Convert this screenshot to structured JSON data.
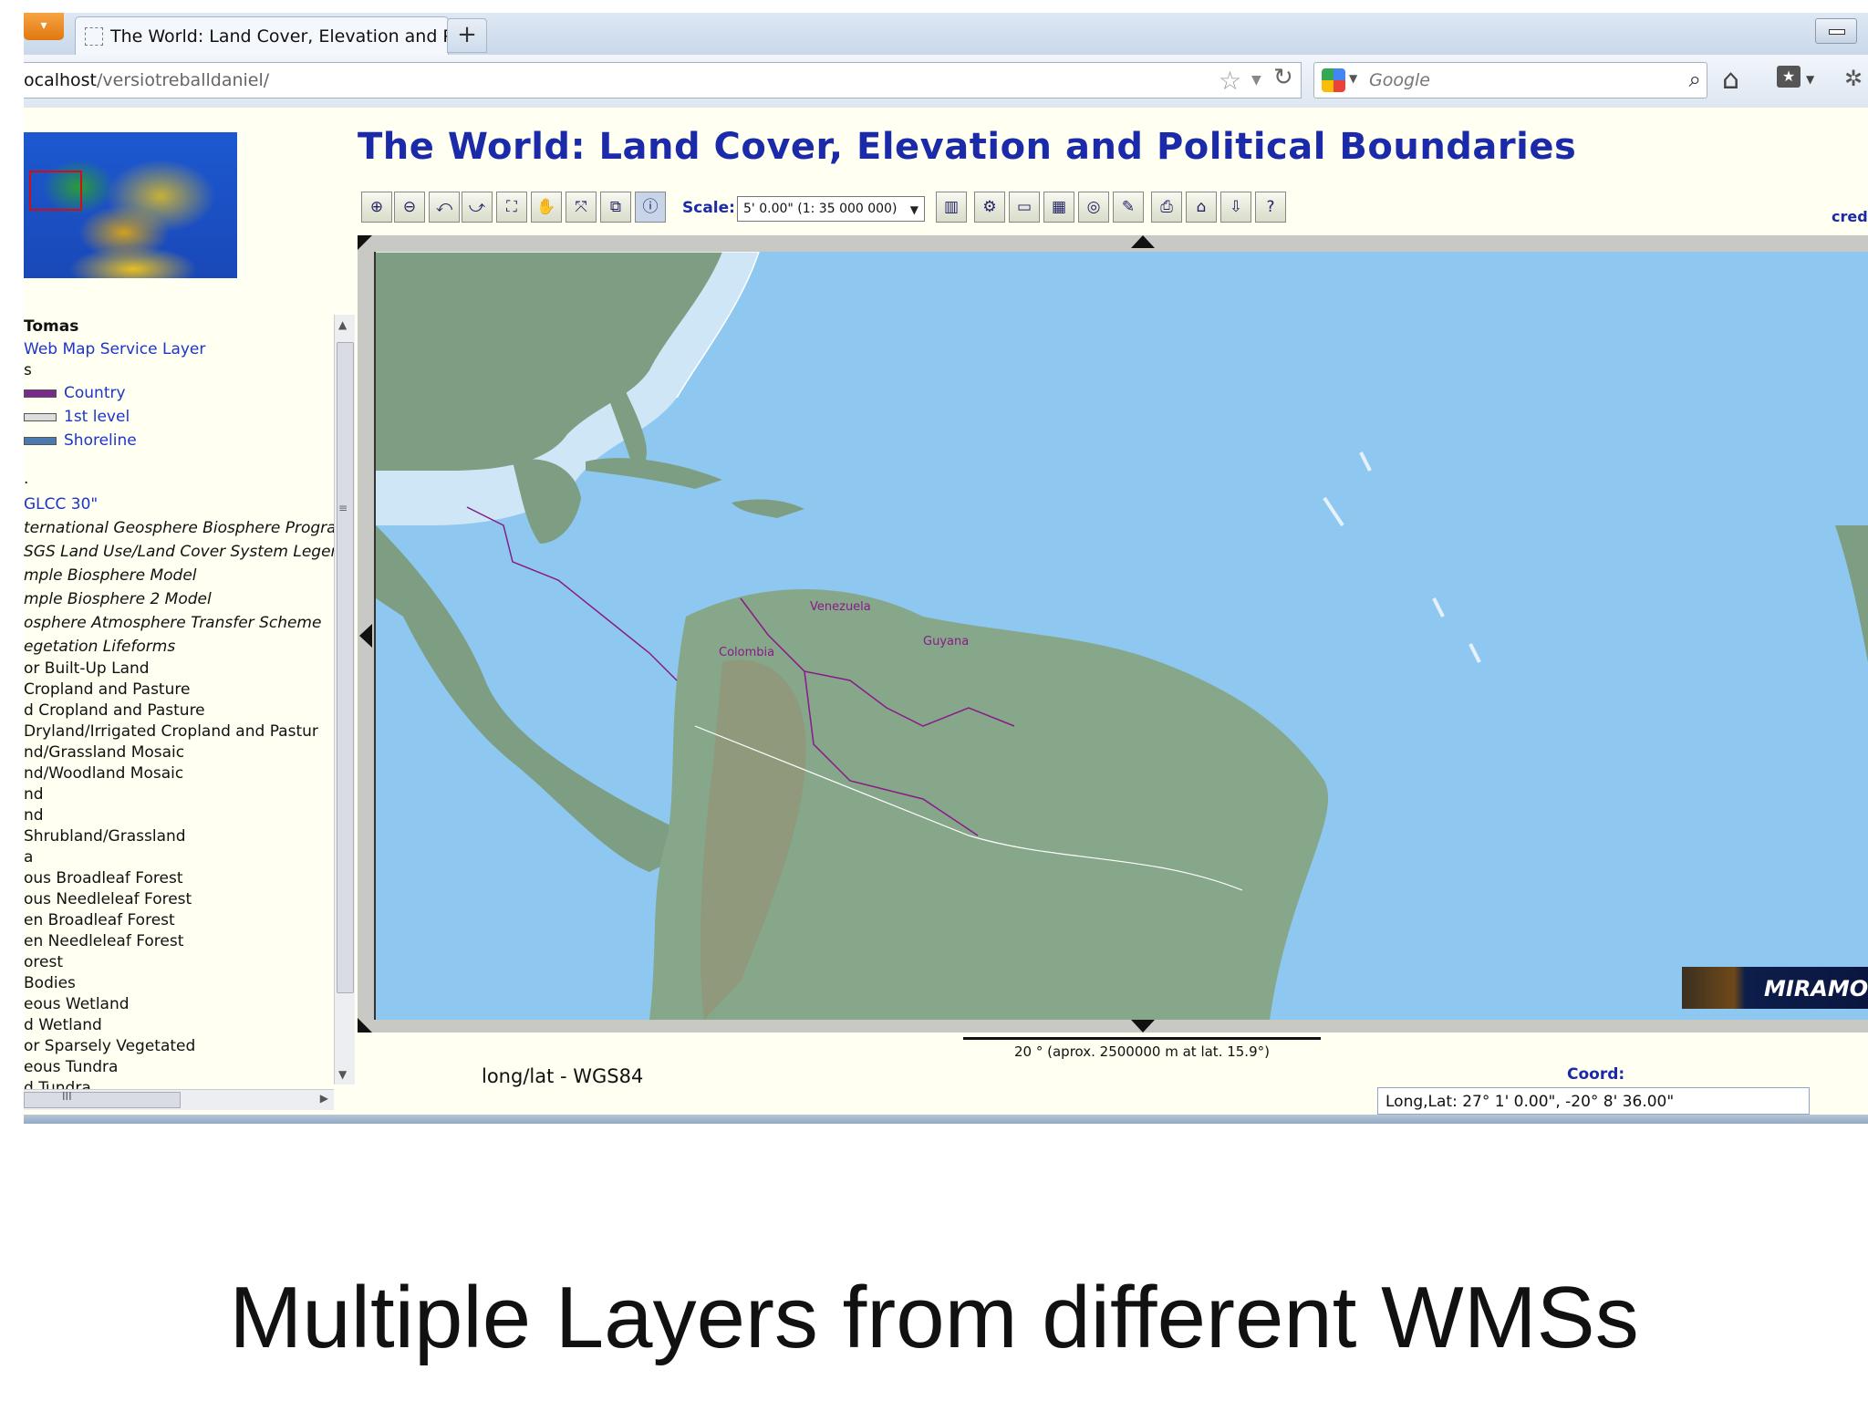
{
  "browser": {
    "tab_title": "The World: Land Cover, Elevation and P...",
    "new_tab": "+",
    "url_host": "ocalhost",
    "url_path": "/versiotreballdaniel/",
    "search_placeholder": "Google"
  },
  "page": {
    "title": "The World: Land Cover, Elevation and Political Boundaries",
    "credits": "cred",
    "scale_label": "Scale:",
    "scale_value": "5' 0.00\" (1: 35 000 000)",
    "projection": "long/lat - WGS84",
    "scalebar_text": "20 ° (aprox. 2500000 m at lat. 15.9°)",
    "coord_label": "Coord:",
    "coord_value": "Long,Lat: 27° 1' 0.00\", -20° 8' 36.00\""
  },
  "legend": {
    "group": "Tomas",
    "wms_layer": "Web Map Service Layer",
    "s_line": "s",
    "boundaries": [
      {
        "label": "Country",
        "color": "#7a2a8a"
      },
      {
        "label": "1st level",
        "color": "#9a9a9a"
      },
      {
        "label": "Shoreline",
        "color": "#4a7ab0"
      }
    ],
    "dot_line": ".",
    "glcc": "GLCC 30\"",
    "schemes": [
      "ternational Geosphere Biosphere Prograr",
      "SGS Land Use/Land Cover System Leger",
      "mple Biosphere Model",
      "mple Biosphere 2 Model",
      "osphere Atmosphere Transfer Scheme",
      "egetation Lifeforms"
    ],
    "classes": [
      "or Built-Up Land",
      " Cropland and Pasture",
      "d Cropland and Pasture",
      "Dryland/Irrigated Cropland and Pastur",
      "nd/Grassland Mosaic",
      "nd/Woodland Mosaic",
      "nd",
      "nd",
      "Shrubland/Grassland",
      "a",
      "ous Broadleaf Forest",
      "ous Needleleaf Forest",
      "en Broadleaf Forest",
      "en Needleleaf Forest",
      "orest",
      "Bodies",
      "eous Wetland",
      "d Wetland",
      "or Sparsely Vegetated",
      "eous Tundra",
      "d Tundra"
    ],
    "hscroll_grip": "III"
  },
  "map": {
    "labels": [
      "Venezuela",
      "Colombia",
      "Guyana"
    ],
    "logo": "MIRAMON"
  },
  "caption": "Multiple Layers from different WMSs"
}
